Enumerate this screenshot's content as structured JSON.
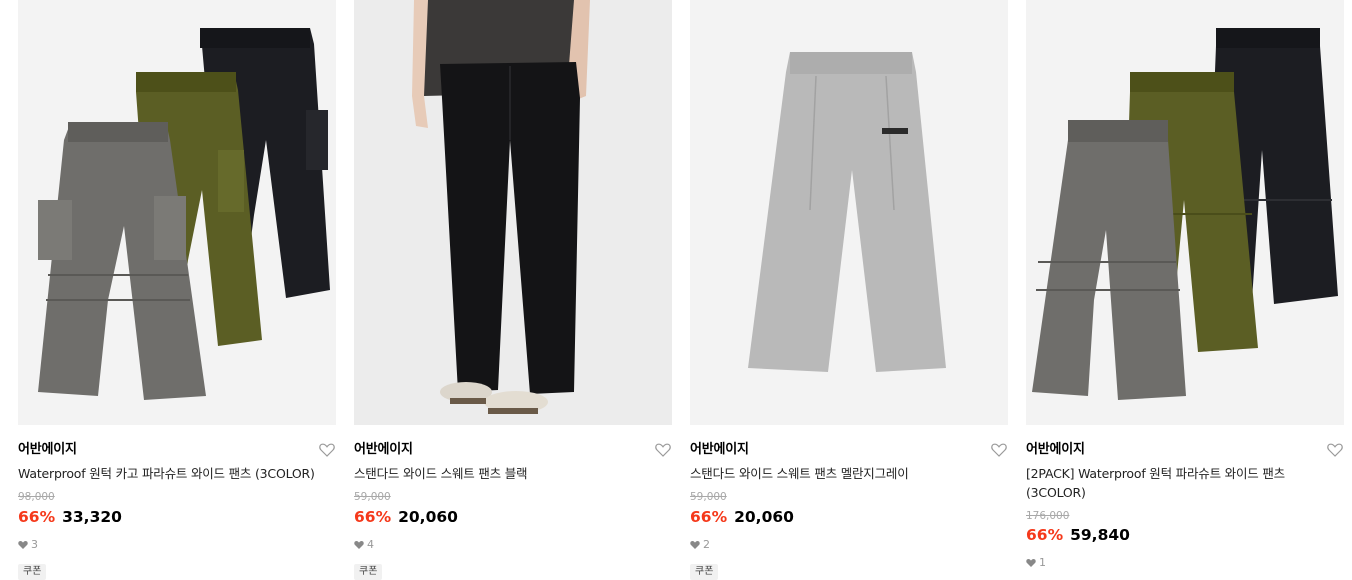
{
  "products": [
    {
      "brand": "어반에이지",
      "name": "Waterproof 원턱 카고 파라슈트 와이드 팬츠 (3COLOR)",
      "original_price": "98,000",
      "discount": "66%",
      "price": "33,320",
      "likes": "3",
      "badge": "쿠폰",
      "image": "three-cargo-parachute-pants"
    },
    {
      "brand": "어반에이지",
      "name": "스탠다드 와이드 스웨트 팬츠 블랙",
      "original_price": "59,000",
      "discount": "66%",
      "price": "20,060",
      "likes": "4",
      "badge": "쿠폰",
      "image": "model-black-sweat-pants"
    },
    {
      "brand": "어반에이지",
      "name": "스탠다드 와이드 스웨트 팬츠 멜란지그레이",
      "original_price": "59,000",
      "discount": "66%",
      "price": "20,060",
      "likes": "2",
      "badge": "쿠폰",
      "image": "grey-sweat-pants"
    },
    {
      "brand": "어반에이지",
      "name": "[2PACK] Waterproof 원턱 파라슈트 와이드 팬츠 (3COLOR)",
      "original_price": "176,000",
      "discount": "66%",
      "price": "59,840",
      "likes": "1",
      "badge": "",
      "image": "three-parachute-pants"
    }
  ],
  "icons": {
    "wishlist": "heart-outline-icon",
    "likes": "heart-filled-icon"
  },
  "colors": {
    "discount": "#f5391b",
    "original_price": "#a8a8a8",
    "background": "#f3f3f3"
  }
}
